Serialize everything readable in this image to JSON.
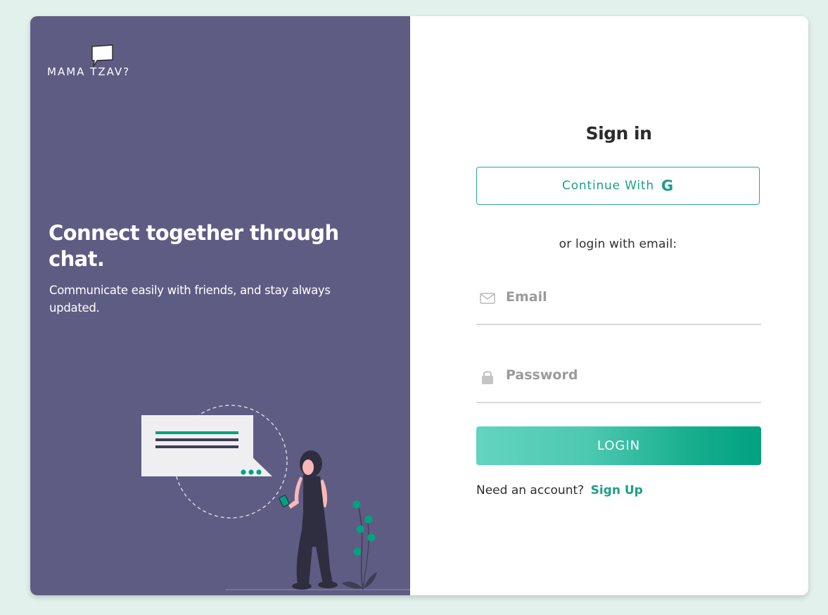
{
  "brand": {
    "logo_text": "MAMA TZAV?"
  },
  "hero": {
    "headline": "Connect together through chat.",
    "subline": "Communicate easily with friends, and stay always updated."
  },
  "signin": {
    "title": "Sign in",
    "google_label": "Continue With",
    "google_icon": "G",
    "divider": "or login with email:",
    "email_placeholder": "Email",
    "password_placeholder": "Password",
    "login_label": "LOGIN",
    "signup_prompt": "Need an account?",
    "signup_link": "Sign Up"
  },
  "colors": {
    "page_bg": "#e2f1ec",
    "panel": "#5f5c83",
    "accent": "#1d9e88"
  }
}
